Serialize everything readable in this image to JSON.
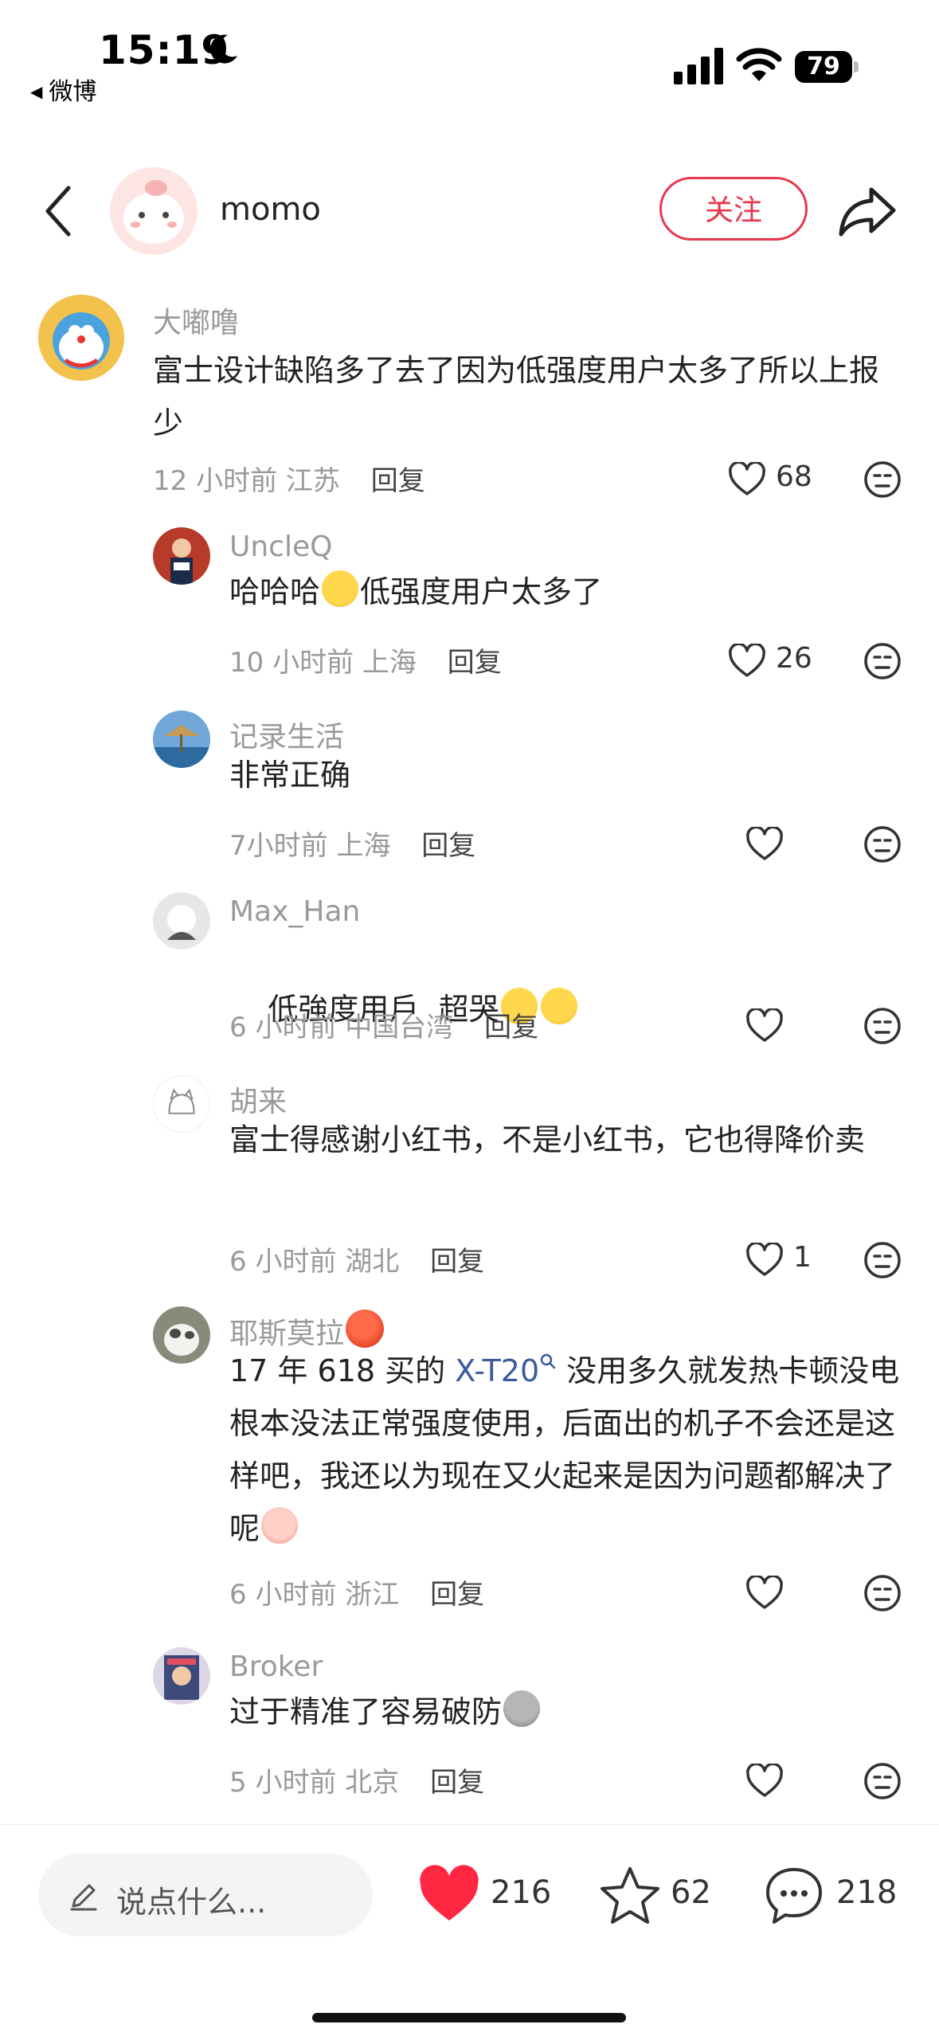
{
  "status_bar": {
    "time": "15:19",
    "back_app": "微博",
    "battery": "79"
  },
  "header": {
    "author_name": "momo",
    "follow_label": "关注"
  },
  "comments": [
    {
      "user": "大嘟噜",
      "text": "富士设计缺陷多了去了因为低强度用户太多了所以上报少",
      "time": "12 小时前",
      "location": "江苏",
      "reply_label": "回复",
      "likes": "68"
    },
    {
      "user": "UncleQ",
      "text_before": "哈哈哈",
      "emoji": "laughing-tears-emoji",
      "text_after": "低强度用户太多了",
      "time": "10 小时前",
      "location": "上海",
      "reply_label": "回复",
      "likes": "26"
    },
    {
      "user": "记录生活",
      "text": "非常正确",
      "time": "7小时前",
      "location": "上海",
      "reply_label": "回复",
      "likes": ""
    },
    {
      "user": "Max_Han",
      "text": "低強度用戶  超哭",
      "emoji": "rofl-emoji",
      "time": "6 小时前",
      "location": "中国台湾",
      "reply_label": "回复",
      "likes": ""
    },
    {
      "user": "胡来",
      "text": "富士得感谢小红书，不是小红书，它也得降价卖",
      "time": "6 小时前",
      "location": "湖北",
      "reply_label": "回复",
      "likes": "1"
    },
    {
      "user": "耶斯莫拉",
      "user_emoji": "tomato-emoji",
      "text_before": "17 年 618 买的 ",
      "link": "X-T20",
      "text_after": " 没用多久就发热卡顿没电根本没法正常强度使用，后面出的机子不会还是这样吧，我还以为现在又火起来是因为问题都解决了呢",
      "emoji": "crying-face-emoji",
      "time": "6 小时前",
      "location": "浙江",
      "reply_label": "回复",
      "likes": ""
    },
    {
      "user": "Broker",
      "text": "过于精准了容易破防",
      "emoji": "grey-blob-emoji",
      "time": "5 小时前",
      "location": "北京",
      "reply_label": "回复",
      "likes": ""
    }
  ],
  "bottom_bar": {
    "input_placeholder": "说点什么...",
    "likes": "216",
    "favorites": "62",
    "comments": "218"
  },
  "colors": {
    "accent_red": "#e8364a",
    "link_blue": "#3b5b9d",
    "meta_gray": "#999999"
  }
}
